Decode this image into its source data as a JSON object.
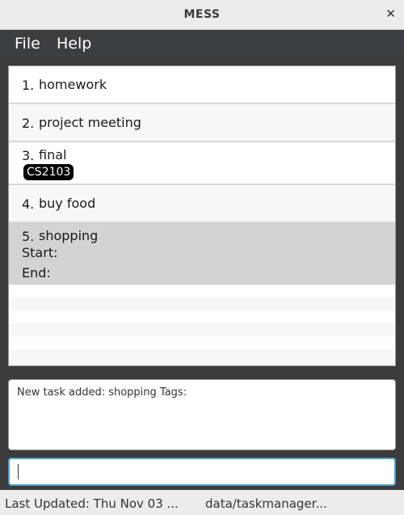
{
  "window": {
    "title": "MESS",
    "close_glyph": "✕"
  },
  "menu": {
    "items": [
      "File",
      "Help"
    ]
  },
  "tasks": [
    {
      "index": "1.",
      "name": "homework"
    },
    {
      "index": "2.",
      "name": "project meeting"
    },
    {
      "index": "3.",
      "name": "final",
      "tag": "CS2103"
    },
    {
      "index": "4.",
      "name": "buy food"
    },
    {
      "index": "5.",
      "name": "shopping",
      "start_label": "Start:",
      "end_label": "End:",
      "selected": true
    }
  ],
  "result": {
    "message": "New task added: shopping Tags:"
  },
  "command": {
    "value": ""
  },
  "status": {
    "last_updated": "Last Updated: Thu Nov 03 ...",
    "file_path": "data/taskmanager..."
  },
  "colors": {
    "selected_row": "#d3d3d3",
    "tag_bg": "#000000",
    "command_border": "#4ba0d0"
  }
}
